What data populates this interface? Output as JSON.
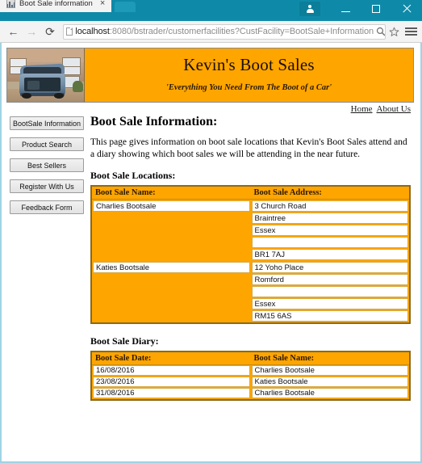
{
  "browser": {
    "tab": {
      "title": "Boot Sale information",
      "favicon": "image-favicon",
      "close_label": "×"
    },
    "new_tab_label": "",
    "nav": {
      "back": "←",
      "forward": "→",
      "reload": "⟳"
    },
    "omnibox": {
      "host": "localhost",
      "rest": ":8080/bstrader/customerfacilities?CustFacility=BootSale+Information",
      "full_url": "localhost:8080/bstrader/customerfacilities?CustFacility=BootSale+Information"
    },
    "window_controls": {
      "minimize": "–",
      "maximize": "□",
      "close": "×"
    },
    "titlebar_color": "#0e8aa8"
  },
  "site": {
    "title": "Kevin's Boot Sales",
    "tagline": "'Everything You Need From The Boot of a Car'",
    "banner_color": "#FFA500",
    "logo_alt": "open car boot photo"
  },
  "top_links": [
    {
      "label": "Home"
    },
    {
      "label": "About Us"
    }
  ],
  "sidebar": {
    "items": [
      {
        "label": "BootSale Information"
      },
      {
        "label": "Product Search"
      },
      {
        "label": "Best Sellers"
      },
      {
        "label": "Register With Us"
      },
      {
        "label": "Feedback Form"
      }
    ]
  },
  "main": {
    "page_title": "Boot Sale Information:",
    "intro": "This page gives information on boot sale locations that Kevin's Boot Sales attend and a diary showing which boot sales we will be attending in the near future.",
    "locations": {
      "heading": "Boot Sale Locations:",
      "columns": [
        "Boot Sale Name:",
        "Boot Sale Address:"
      ],
      "rows": [
        {
          "name": "Charlies Bootsale",
          "address": [
            "3 Church Road",
            "Braintree",
            "Essex",
            "",
            "BR1 7AJ"
          ]
        },
        {
          "name": "Katies Bootsale",
          "address": [
            "12 Yoho Place",
            "Romford",
            "",
            "Essex",
            "RM15 6AS"
          ]
        }
      ]
    },
    "diary": {
      "heading": "Boot Sale Diary:",
      "columns": [
        "Boot Sale Date:",
        "Boot Sale Name:"
      ],
      "rows": [
        {
          "date": "16/08/2016",
          "name": "Charlies Bootsale"
        },
        {
          "date": "23/08/2016",
          "name": "Katies Bootsale"
        },
        {
          "date": "31/08/2016",
          "name": "Charlies Bootsale"
        }
      ]
    }
  }
}
